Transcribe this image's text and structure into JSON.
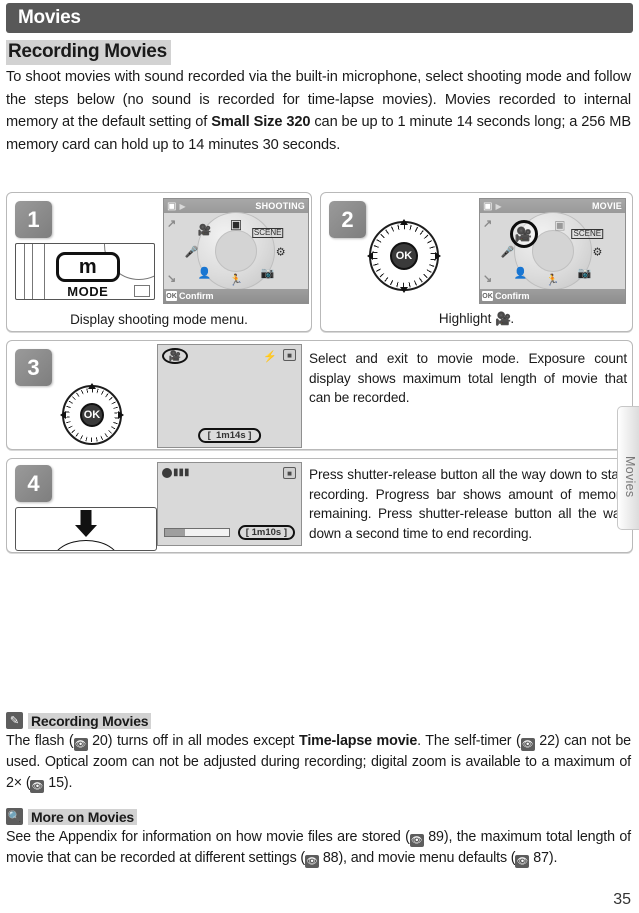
{
  "chapter": {
    "title": "Movies",
    "side_tab_label": "Movies"
  },
  "section": {
    "heading": "Recording Movies"
  },
  "intro": {
    "part1": "To shoot movies with sound recorded via the built-in microphone, select shooting mode and follow the steps below (no sound is recorded for time-lapse movies). Movies recorded to internal memory at the default setting of ",
    "bold": "Small Size 320",
    "part2": " can be up to 1 minute 14 seconds long; a 256 MB memory card can hold up to 14 minutes 30 seconds."
  },
  "steps": [
    {
      "number": "1",
      "caption": "Display shooting mode menu.",
      "camera_button_label": "m",
      "camera_button_text": "MODE",
      "lcd": {
        "mode_label": "SHOOTING",
        "confirm_label": "Confirm",
        "ok_key": "OK",
        "selected": "camera"
      }
    },
    {
      "number": "2",
      "caption_prefix": "Highlight ",
      "caption_suffix": ".",
      "selector_center": "OK",
      "lcd": {
        "mode_label": "MOVIE",
        "confirm_label": "Confirm",
        "ok_key": "OK",
        "selected": "movie"
      }
    },
    {
      "number": "3",
      "selector_center": "OK",
      "text": "Select and exit to movie mode.  Exposure count display shows maximum total length of movie that can be recorded.",
      "lcd": {
        "mode_icon": "movie-mode-icon",
        "flash_off_icon": "flash-off-icon",
        "memory_icon": "internal-memory-icon",
        "exposure_count": "1m14s"
      }
    },
    {
      "number": "4",
      "text": "Press shutter-release button all the way down to start recording.  Progress bar shows amount of memory remaining.  Press shutter-release button all the way down a second time to end recording.",
      "lcd": {
        "rec_icon": "recording-icon",
        "memory_icon": "internal-memory-icon",
        "progress_percent": 32,
        "time_remaining": "1m10s"
      }
    }
  ],
  "notes": [
    {
      "icon": "pencil-icon",
      "title": "Recording Movies",
      "segments": [
        {
          "t": "text",
          "v": "The flash ("
        },
        {
          "t": "ref",
          "v": "20) turns off in all modes except "
        },
        {
          "t": "bold",
          "v": "Time-lapse movie"
        },
        {
          "t": "text",
          "v": ".  The self-timer ("
        },
        {
          "t": "ref",
          "v": "22) can not be used.  Optical zoom can not be adjusted during recording; digital zoom is available to a maximum of 2× ("
        },
        {
          "t": "ref",
          "v": "15)."
        }
      ],
      "body_plain": "The flash (20) turns off in all modes except Time-lapse movie.  The self-timer (22) can not be used.  Optical zoom can not be adjusted during recording; digital zoom is available to a maximum of 2x (15)."
    },
    {
      "icon": "magnifier-icon",
      "title": "More on Movies",
      "body_plain": "See the Appendix for information on how movie files are stored (89), the maximum total length of movie that can be recorded at different settings (88), and movie menu defaults (87)."
    }
  ],
  "note1_refs": [
    "20",
    "22",
    "15"
  ],
  "note2_refs": [
    "89",
    "88",
    "87"
  ],
  "page_number": "35",
  "colors": {
    "chapter_bar": "#585858",
    "heading_highlight": "#d2d2d2",
    "step_number_bg": "#8c8c8c",
    "lcd_bg": "#d9d9d9"
  }
}
